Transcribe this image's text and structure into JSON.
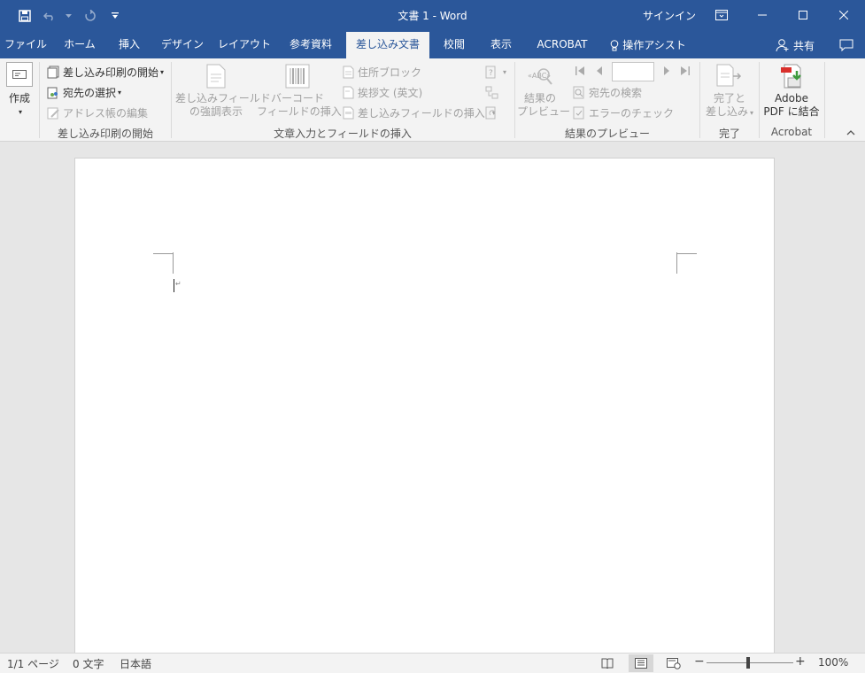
{
  "window": {
    "title": "文書 1  -  Word",
    "signin": "サインイン"
  },
  "tabs": [
    {
      "label": "ファイル"
    },
    {
      "label": "ホーム"
    },
    {
      "label": "挿入"
    },
    {
      "label": "デザイン"
    },
    {
      "label": "レイアウト"
    },
    {
      "label": "参考資料"
    },
    {
      "label": "差し込み文書",
      "active": true
    },
    {
      "label": "校閲"
    },
    {
      "label": "表示"
    },
    {
      "label": "ACROBAT"
    },
    {
      "label": "操作アシスト"
    }
  ],
  "share_label": "共有",
  "ribbon": {
    "create": {
      "label": "作成"
    },
    "start_group": {
      "start_merge": "差し込み印刷の開始",
      "select_recipients": "宛先の選択",
      "edit_address_book": "アドレス帳の編集",
      "label": "差し込み印刷の開始"
    },
    "write_group": {
      "highlight_fields_1": "差し込みフィールド",
      "highlight_fields_2": "の強調表示",
      "barcode_1": "バーコード",
      "barcode_2": "フィールドの挿入",
      "address_block": "住所ブロック",
      "greeting_line": "挨拶文 (英文)",
      "insert_merge_field": "差し込みフィールドの挿入",
      "label": "文章入力とフィールドの挿入"
    },
    "preview_group": {
      "preview_1": "結果の",
      "preview_2": "プレビュー",
      "find_recipient": "宛先の検索",
      "check_errors": "エラーのチェック",
      "label": "結果のプレビュー",
      "record_number": ""
    },
    "finish_group": {
      "finish_1": "完了と",
      "finish_2": "差し込み",
      "label": "完了"
    },
    "acrobat_group": {
      "adobe_1": "Adobe",
      "adobe_2": "PDF に結合",
      "label": "Acrobat"
    }
  },
  "statusbar": {
    "page": "1/1 ページ",
    "words": "0 文字",
    "language": "日本語",
    "zoom": "100%",
    "zoom_level_percent": 100
  },
  "colors": {
    "brand": "#2b579a",
    "ribbon_bg": "#f3f3f3",
    "disabled_text": "#a0a0a0"
  }
}
